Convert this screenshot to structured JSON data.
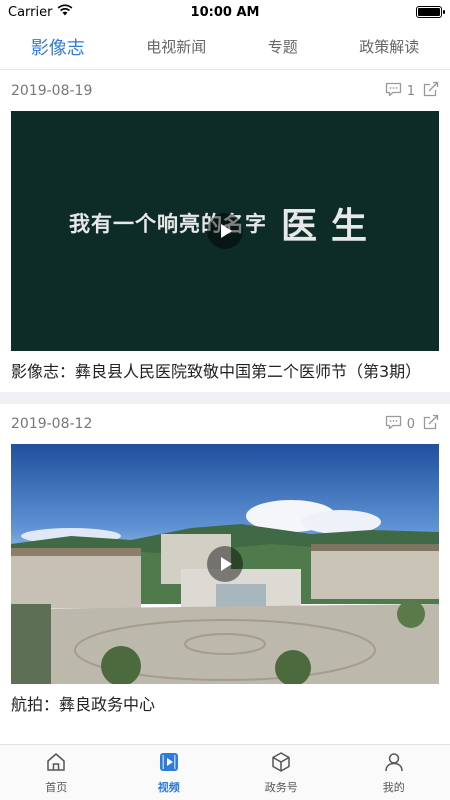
{
  "status_bar": {
    "carrier": "Carrier",
    "time": "10:00 AM",
    "battery_level": 1.0
  },
  "tabs": [
    {
      "label": "影像志",
      "active": true
    },
    {
      "label": "电视新闻",
      "active": false
    },
    {
      "label": "专题",
      "active": false
    },
    {
      "label": "政策解读",
      "active": false
    }
  ],
  "feed": [
    {
      "date": "2019-08-19",
      "comment_count": "1",
      "video_text_small": "我有一个响亮的名字",
      "video_text_big": "医生",
      "title": "影像志：彝良县人民医院致敬中国第二个医师节（第3期）"
    },
    {
      "date": "2019-08-12",
      "comment_count": "0",
      "title": "航拍：彝良政务中心"
    }
  ],
  "bottom_nav": [
    {
      "label": "首页",
      "icon": "home-icon",
      "active": false
    },
    {
      "label": "视频",
      "icon": "video-icon",
      "active": true
    },
    {
      "label": "政务号",
      "icon": "cube-icon",
      "active": false
    },
    {
      "label": "我的",
      "icon": "user-icon",
      "active": false
    }
  ],
  "colors": {
    "accent": "#2f7bd8",
    "separator": "#efeff4"
  }
}
